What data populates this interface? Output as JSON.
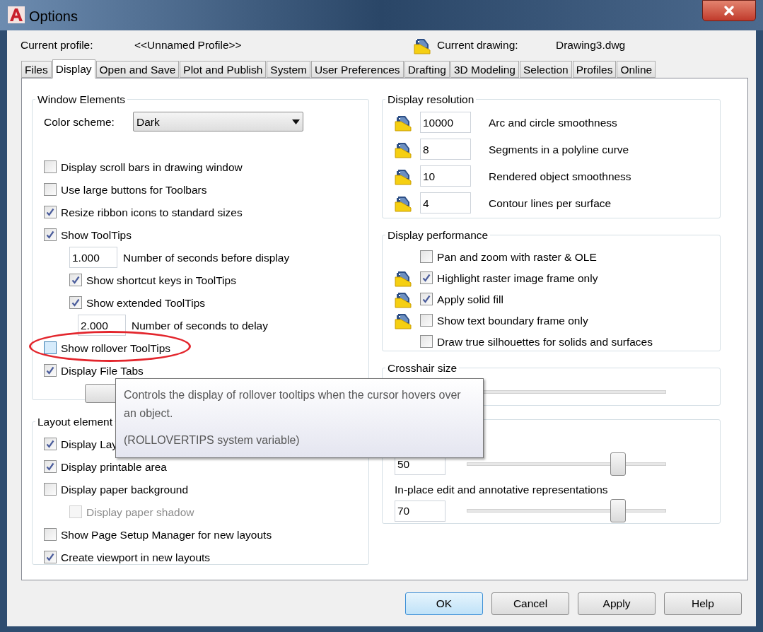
{
  "window": {
    "title": "Options"
  },
  "header": {
    "profile_label": "Current profile:",
    "profile_value": "<<Unnamed Profile>>",
    "drawing_label": "Current drawing:",
    "drawing_value": "Drawing3.dwg"
  },
  "tabs": [
    {
      "label": "Files",
      "selected": false
    },
    {
      "label": "Display",
      "selected": true
    },
    {
      "label": "Open and Save",
      "selected": false
    },
    {
      "label": "Plot and Publish",
      "selected": false
    },
    {
      "label": "System",
      "selected": false
    },
    {
      "label": "User Preferences",
      "selected": false
    },
    {
      "label": "Drafting",
      "selected": false
    },
    {
      "label": "3D Modeling",
      "selected": false
    },
    {
      "label": "Selection",
      "selected": false
    },
    {
      "label": "Profiles",
      "selected": false
    },
    {
      "label": "Online",
      "selected": false
    }
  ],
  "window_elements": {
    "title": "Window Elements",
    "color_scheme": {
      "label": "Color scheme:",
      "value": "Dark"
    },
    "items": [
      {
        "kind": "checkbox",
        "label": "Display scroll bars in drawing window",
        "checked": false,
        "hovered": false,
        "circled": false
      },
      {
        "kind": "checkbox",
        "label": "Use large buttons for Toolbars",
        "checked": false,
        "hovered": false,
        "circled": false
      },
      {
        "kind": "checkbox",
        "label": "Resize ribbon icons to standard sizes",
        "checked": true,
        "hovered": false,
        "circled": false
      },
      {
        "kind": "checkbox",
        "label": "Show ToolTips",
        "checked": true,
        "hovered": false,
        "circled": false,
        "children": [
          {
            "kind": "field",
            "value": "1.000",
            "label": "Number of seconds before display"
          },
          {
            "kind": "checkbox",
            "label": "Show shortcut keys in ToolTips",
            "checked": true
          },
          {
            "kind": "checkbox",
            "label": "Show extended ToolTips",
            "checked": true,
            "children": [
              {
                "kind": "field",
                "value": "2.000",
                "label": "Number of seconds to delay"
              }
            ]
          }
        ]
      },
      {
        "kind": "checkbox",
        "label": "Show rollover ToolTips",
        "checked": false,
        "hovered": true,
        "circled": true
      },
      {
        "kind": "checkbox",
        "label": "Display File Tabs",
        "checked": true,
        "hovered": false,
        "circled": false
      },
      {
        "kind": "button"
      }
    ]
  },
  "layout_elements": {
    "title": "Layout element",
    "items": [
      {
        "kind": "checkbox",
        "label": "Display Lay",
        "checked": true
      },
      {
        "kind": "checkbox",
        "label": "Display printable area",
        "checked": true
      },
      {
        "kind": "checkbox",
        "label": "Display paper background",
        "checked": false,
        "children": [
          {
            "kind": "checkbox",
            "label": "Display paper shadow",
            "checked": false,
            "disabled": true
          }
        ]
      },
      {
        "kind": "checkbox",
        "label": "Show Page Setup Manager for new layouts",
        "checked": false
      },
      {
        "kind": "checkbox",
        "label": "Create viewport in new layouts",
        "checked": true
      }
    ]
  },
  "display_resolution": {
    "title": "Display resolution",
    "rows": [
      {
        "value": "10000",
        "label": "Arc and circle smoothness"
      },
      {
        "value": "8",
        "label": "Segments in a polyline curve"
      },
      {
        "value": "10",
        "label": "Rendered object smoothness"
      },
      {
        "value": "4",
        "label": "Contour lines per surface"
      }
    ]
  },
  "display_performance": {
    "title": "Display performance",
    "items": [
      {
        "label": "Pan and zoom with raster & OLE",
        "checked": false,
        "drawing_icon": false
      },
      {
        "label": "Highlight raster image frame only",
        "checked": true,
        "drawing_icon": true
      },
      {
        "label": "Apply solid fill",
        "checked": true,
        "drawing_icon": true
      },
      {
        "label": "Show text boundary frame only",
        "checked": false,
        "drawing_icon": true
      },
      {
        "label": "Draw true silhouettes for solids and surfaces",
        "checked": false,
        "drawing_icon": false
      }
    ]
  },
  "crosshair": {
    "title": "Crosshair size"
  },
  "fade_control": {
    "sliders": [
      {
        "value": "50",
        "level": 0.76
      },
      {
        "label": "In-place edit and annotative representations",
        "value": "70",
        "level": 0.76
      }
    ]
  },
  "tooltip": {
    "text": "Controls the display of rollover tooltips when the cursor hovers over an object.",
    "note": "(ROLLOVERTIPS system variable)"
  },
  "buttons": [
    {
      "label": "OK",
      "default": true
    },
    {
      "label": "Cancel",
      "default": false
    },
    {
      "label": "Apply",
      "default": false
    },
    {
      "label": "Help",
      "default": false
    }
  ]
}
